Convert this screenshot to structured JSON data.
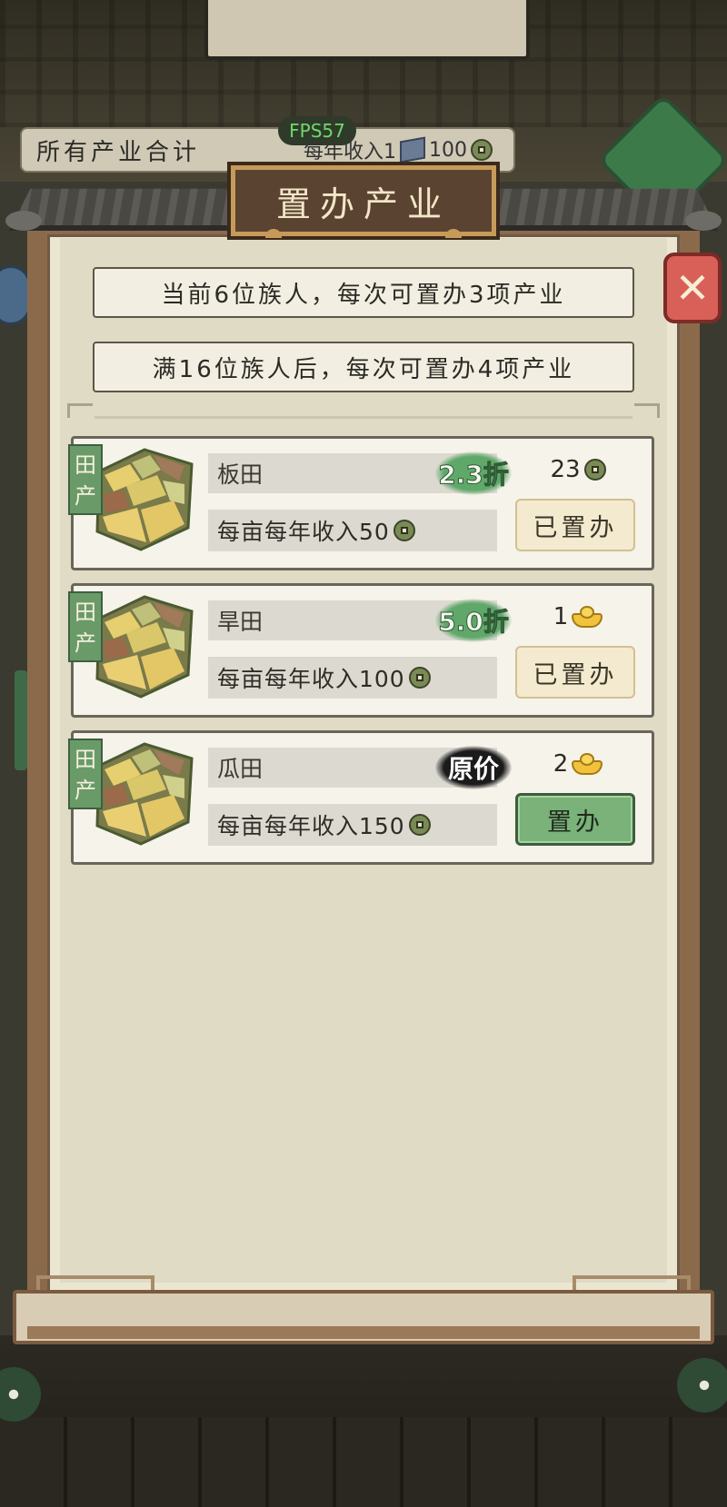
{
  "header": {
    "summary_label": "所有产业合计",
    "summary_income_label": "每年收入1",
    "summary_income_value": "100",
    "fps": "FPS57"
  },
  "dialog": {
    "title": "置办产业",
    "info_lines": [
      "当前6位族人，每次可置办3项产业",
      "满16位族人后，每次可置办4项产业"
    ],
    "items": [
      {
        "tag": "田产",
        "name": "板田",
        "discount": "2.3折",
        "discount_style": "green",
        "price": "23",
        "currency": "coin-icon",
        "income": "每亩每年收入50",
        "action": "已置办",
        "action_state": "done"
      },
      {
        "tag": "田产",
        "name": "旱田",
        "discount": "5.0折",
        "discount_style": "green",
        "price": "1",
        "currency": "ingot-icon",
        "income": "每亩每年收入100",
        "action": "已置办",
        "action_state": "done"
      },
      {
        "tag": "田产",
        "name": "瓜田",
        "discount": "原价",
        "discount_style": "black",
        "price": "2",
        "currency": "ingot-icon",
        "income": "每亩每年收入150",
        "action": "置办",
        "action_state": "buy"
      }
    ]
  },
  "colors": {
    "panel": "#e0dbc4",
    "card": "#f6f3ea",
    "tag_green": "#6a9a68",
    "buy_button": "#7bb279",
    "close_button": "#d86058"
  }
}
